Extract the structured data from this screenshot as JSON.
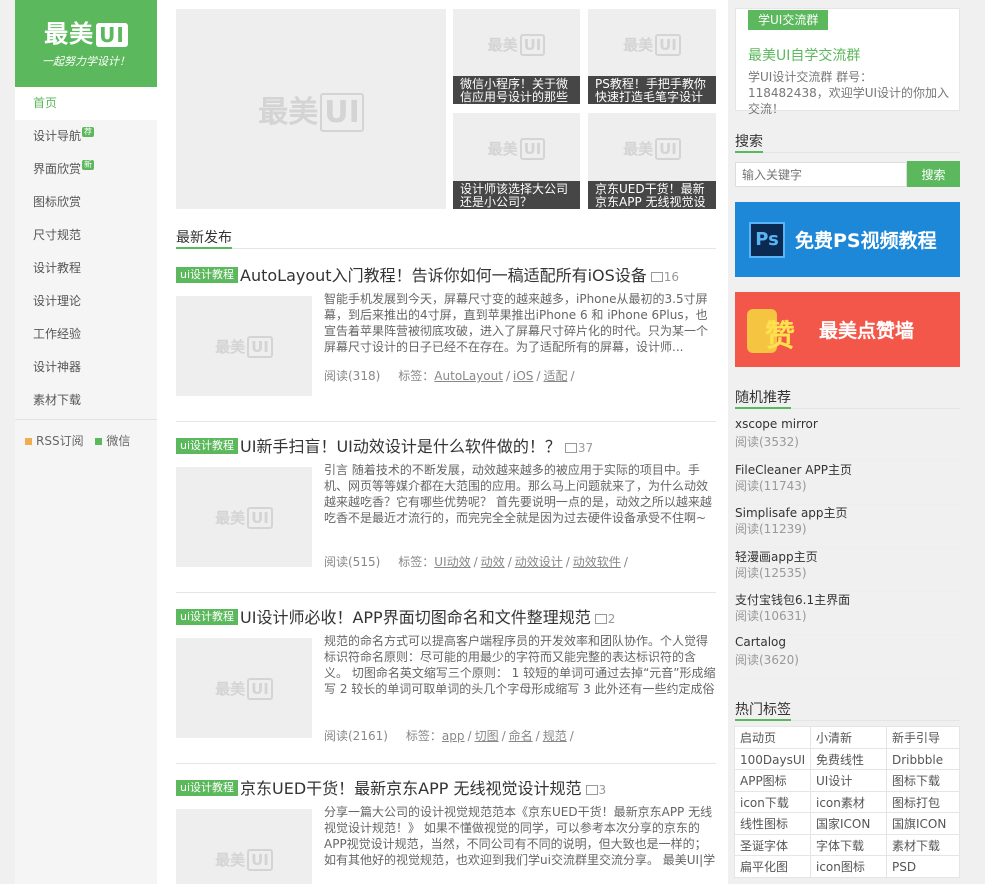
{
  "logo": {
    "brand": "最美",
    "brand_ui": "UI",
    "slogan": "一起努力学设计！"
  },
  "nav": {
    "items": [
      {
        "label": "首页",
        "active": true,
        "badge": ""
      },
      {
        "label": "设计导航",
        "badge": "荐"
      },
      {
        "label": "界面欣赏",
        "badge": "新"
      },
      {
        "label": "图标欣赏",
        "badge": ""
      },
      {
        "label": "尺寸规范",
        "badge": ""
      },
      {
        "label": "设计教程",
        "badge": ""
      },
      {
        "label": "设计理论",
        "badge": ""
      },
      {
        "label": "工作经验",
        "badge": ""
      },
      {
        "label": "设计神器",
        "badge": ""
      },
      {
        "label": "素材下载",
        "badge": ""
      }
    ],
    "rss": "RSS订阅",
    "weixin": "微信"
  },
  "watermark": {
    "text": "最美",
    "ui": "UI"
  },
  "featured": [
    {
      "caption": "微信小程序！关于微信应用号设计的那些事"
    },
    {
      "caption": "PS教程！手把手教你快速打造毛笔字设计"
    },
    {
      "caption": "设计师该选择大公司还是小公司？"
    },
    {
      "caption": "京东UED干货！最新京东APP 无线视觉设计规范"
    }
  ],
  "latest_title": "最新发布",
  "posts": [
    {
      "category": "ui设计教程",
      "title": "AutoLayout入门教程！告诉你如何一稿适配所有iOS设备",
      "img_count": "16",
      "excerpt": "智能手机发展到今天，屏幕尺寸变的越来越多，iPhone从最初的3.5寸屏幕，到后来推出的4寸屏，直到苹果推出iPhone 6 和 iPhone 6Plus，也宣告着苹果阵营被彻底攻破，进入了屏幕尺寸碎片化的时代。只为某一个屏幕尺寸设计的日子已经不在存在。为了适配所有的屏幕，设计师...",
      "reads": "阅读(318)",
      "tags_label": "标签：",
      "tags": [
        "AutoLayout",
        "iOS",
        "适配"
      ]
    },
    {
      "category": "ui设计教程",
      "title": "UI新手扫盲！UI动效设计是什么软件做的！？",
      "img_count": "37",
      "excerpt": "引言 随着技术的不断发展，动效越来越多的被应用于实际的项目中。手机、网页等等媒介都在大范围的应用。那么马上问题就来了，为什么动效越来越吃香？它有哪些优势呢？ 首先要说明一点的是，动效之所以越来越吃香不是最近才流行的，而完完全全就是因为过去硬件设备承受不住啊~ 过去要是在手机里搞个...",
      "reads": "阅读(515)",
      "tags_label": "标签：",
      "tags": [
        "UI动效",
        "动效",
        "动效设计",
        "动效软件"
      ]
    },
    {
      "category": "ui设计教程",
      "title": "UI设计师必收！APP界面切图命名和文件整理规范",
      "img_count": "2",
      "excerpt": "规范的命名方式可以提高客户端程序员的开发效率和团队协作。个人觉得标识符命名原则：尽可能的用最少的字符而又能完整的表达标识符的含义。 切图命名英文缩写三个原则： 1 较短的单词可通过去掉“元音”形成缩写 2 较长的单词可取单词的头几个字母形成缩写 3 此外还有一些约定成俗的英文单词...",
      "reads": "阅读(2161)",
      "tags_label": "标签：",
      "tags": [
        "app",
        "切图",
        "命名",
        "规范"
      ]
    },
    {
      "category": "ui设计教程",
      "title": "京东UED干货！最新京东APP 无线视觉设计规范",
      "img_count": "3",
      "excerpt": "分享一篇大公司的设计视觉规范范本《京东UED干货！最新京东APP 无线视觉设计规范！》 如果不懂做视觉的同学，可以参考本次分享的京东的APP视觉设计规范，当然，不同公司有不同的说明，但大致也是一样的；如有其他好的视觉规范，也欢迎到我们学ui交流群里交流分享。 最美UI|学ui设计...",
      "reads": "",
      "tags_label": "",
      "tags": []
    }
  ],
  "qq_group": {
    "tag": "学UI交流群",
    "name": "最美UI自学交流群",
    "desc": "学UI设计交流群 群号：118482438，欢迎学UI设计的你加入交流！"
  },
  "search": {
    "title": "搜索",
    "placeholder": "输入关键字",
    "button": "搜索"
  },
  "banners": {
    "ps_icon": "Ps",
    "ps_text": "免费PS视频教程",
    "zan_icon": "赞",
    "zan_text": "最美点赞墙"
  },
  "random": {
    "title": "随机推荐",
    "items": [
      {
        "name": "xscope mirror",
        "views": "阅读(3532)"
      },
      {
        "name": "FileCleaner APP主页",
        "views": "阅读(11743)"
      },
      {
        "name": "Simplisafe app主页",
        "views": "阅读(11239)"
      },
      {
        "name": "轻漫画app主页",
        "views": "阅读(12535)"
      },
      {
        "name": "支付宝钱包6.1主界面",
        "views": "阅读(10631)"
      },
      {
        "name": "Cartalog",
        "views": "阅读(3620)"
      }
    ]
  },
  "hot_tags": {
    "title": "热门标签",
    "items": [
      "启动页",
      "小清新",
      "新手引导",
      "100DaysUI",
      "免费线性",
      "Dribbble",
      "APP图标",
      "UI设计",
      "图标下载",
      "icon下载",
      "icon素材",
      "图标打包",
      "线性图标",
      "国家ICON",
      "国旗ICON",
      "圣诞字体",
      "字体下载",
      "素材下载",
      "扁平化图",
      "icon图标",
      "PSD"
    ]
  },
  "colors": {
    "accent": "#5cb85c",
    "ps_banner": "#1d87d8",
    "zan_banner": "#f2574a"
  }
}
